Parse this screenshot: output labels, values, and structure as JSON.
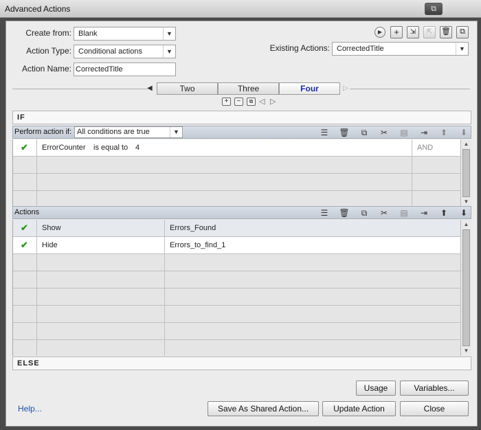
{
  "window": {
    "title": "Advanced Actions",
    "restore_symbol": "⧉"
  },
  "form": {
    "create_from_label": "Create from:",
    "create_from_value": "Blank",
    "action_type_label": "Action Type:",
    "action_type_value": "Conditional actions",
    "action_name_label": "Action Name:",
    "action_name_value": "CorrectedTitle",
    "existing_actions_label": "Existing Actions:",
    "existing_actions_value": "CorrectedTitle"
  },
  "decisions": {
    "tabs": [
      "Two",
      "Three",
      "Four"
    ],
    "active_tab": "Four"
  },
  "if_section": {
    "header": "IF",
    "perform_label": "Perform action if:",
    "perform_value": "All conditions are true",
    "conditions": [
      {
        "variable": "ErrorCounter",
        "operator": "is equal to",
        "value": "4",
        "logic": "AND"
      }
    ]
  },
  "actions_section": {
    "header": "Actions",
    "rows": [
      {
        "action": "Show",
        "target": "Errors_Found"
      },
      {
        "action": "Hide",
        "target": "Errors_to_find_1"
      }
    ]
  },
  "else_section": {
    "header": "ELSE"
  },
  "buttons": {
    "usage": "Usage",
    "variables": "Variables...",
    "save_shared": "Save As Shared Action...",
    "update": "Update Action",
    "close": "Close",
    "help": "Help..."
  }
}
